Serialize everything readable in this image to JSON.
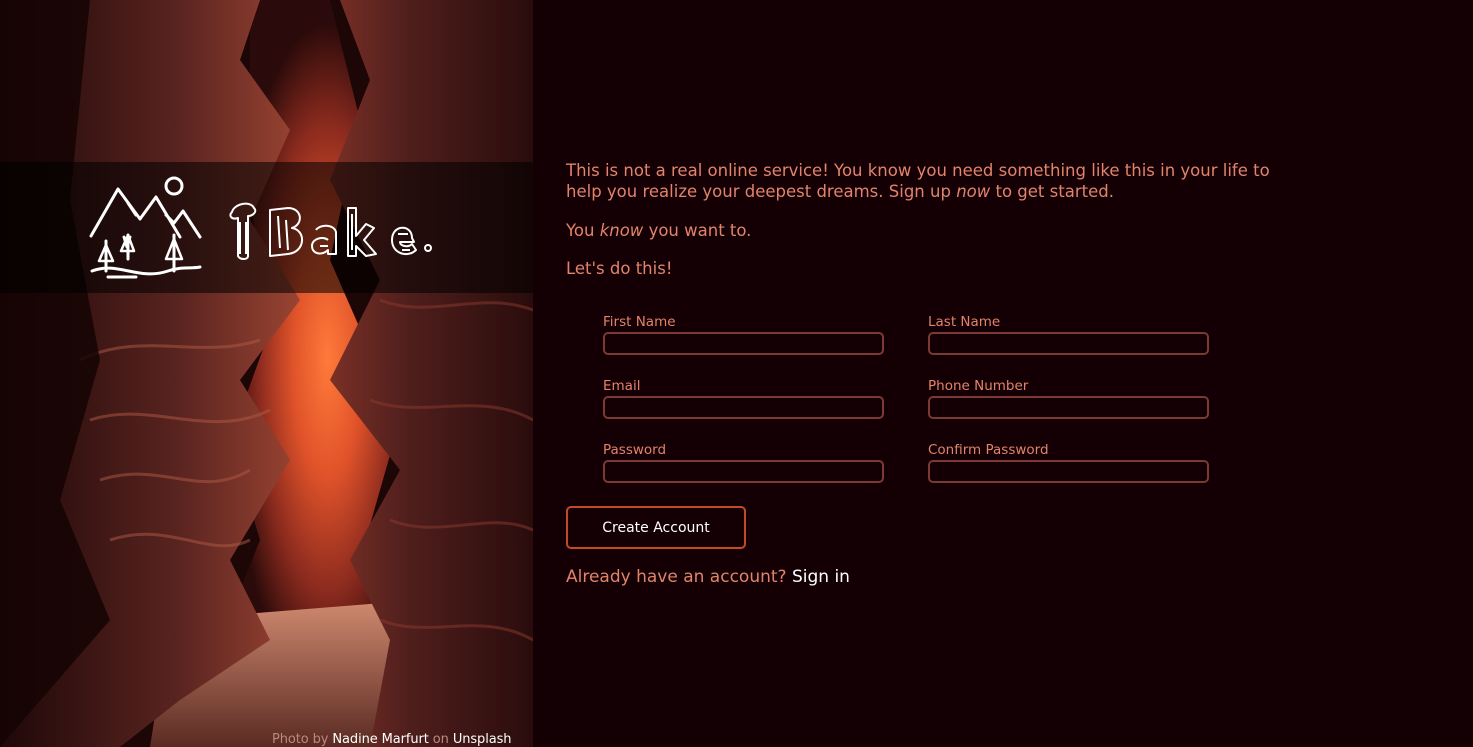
{
  "brand": {
    "name": "TBake",
    "logo_icon": "mountain-logo-icon"
  },
  "credit": {
    "prefix": "Photo by",
    "author": "Nadine Marfurt",
    "on": "on",
    "source": "Unsplash"
  },
  "intro": {
    "p1_part1": "This is not a real online service! You know you need something like this in your life to help you realize your deepest dreams. Sign up",
    "p1_em": "now",
    "p1_part2": "to get started.",
    "p2_part1": "You",
    "p2_em": "know",
    "p2_part2": "you want to.",
    "p3": "Let's do this!"
  },
  "form": {
    "first_name_label": "First Name",
    "last_name_label": "Last Name",
    "email_label": "Email",
    "phone_label": "Phone Number",
    "password_label": "Password",
    "confirm_password_label": "Confirm Password",
    "first_name_value": "",
    "last_name_value": "",
    "email_value": "",
    "phone_value": "",
    "password_value": "",
    "confirm_password_value": ""
  },
  "create_button_label": "Create Account",
  "signin": {
    "prompt": "Already have an account?",
    "link_label": "Sign in"
  },
  "colors": {
    "background": "#140004",
    "text": "#e2836a",
    "input_border": "#7a3a34",
    "button_border": "#c24a24",
    "link": "#ffffff"
  }
}
